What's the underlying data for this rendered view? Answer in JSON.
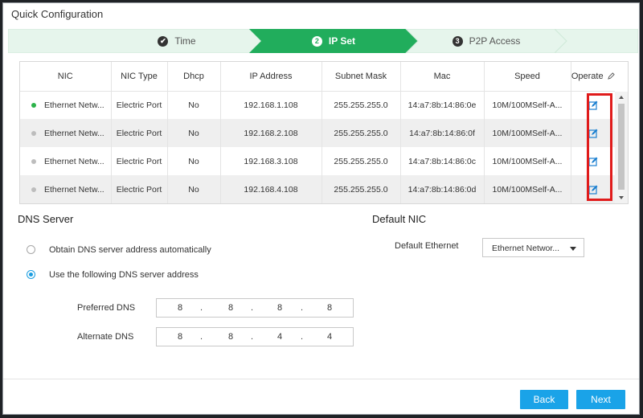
{
  "dialog": {
    "title": "Quick Configuration"
  },
  "steps": [
    {
      "label": "Time",
      "marker": "✔",
      "state": "done"
    },
    {
      "label": "IP Set",
      "marker": "2",
      "state": "active"
    },
    {
      "label": "P2P Access",
      "marker": "3",
      "state": "pending"
    }
  ],
  "table": {
    "headers": [
      "NIC",
      "NIC Type",
      "Dhcp",
      "IP Address",
      "Subnet Mask",
      "Mac",
      "Speed",
      "Operate"
    ],
    "rows": [
      {
        "status": "online",
        "status_color": "#2db34a",
        "nic": "Ethernet Netw...",
        "type": "Electric Port",
        "dhcp": "No",
        "ip": "192.168.1.108",
        "mask": "255.255.255.0",
        "mac": "14:a7:8b:14:86:0e",
        "speed": "10M/100MSelf-A..."
      },
      {
        "status": "offline",
        "status_color": "#bdbdbd",
        "nic": "Ethernet Netw...",
        "type": "Electric Port",
        "dhcp": "No",
        "ip": "192.168.2.108",
        "mask": "255.255.255.0",
        "mac": "14:a7:8b:14:86:0f",
        "speed": "10M/100MSelf-A..."
      },
      {
        "status": "offline",
        "status_color": "#bdbdbd",
        "nic": "Ethernet Netw...",
        "type": "Electric Port",
        "dhcp": "No",
        "ip": "192.168.3.108",
        "mask": "255.255.255.0",
        "mac": "14:a7:8b:14:86:0c",
        "speed": "10M/100MSelf-A..."
      },
      {
        "status": "offline",
        "status_color": "#bdbdbd",
        "nic": "Ethernet Netw...",
        "type": "Electric Port",
        "dhcp": "No",
        "ip": "192.168.4.108",
        "mask": "255.255.255.0",
        "mac": "14:a7:8b:14:86:0d",
        "speed": "10M/100MSelf-A..."
      }
    ]
  },
  "dns": {
    "title": "DNS Server",
    "auto_label": "Obtain DNS server address automatically",
    "manual_label": "Use the following DNS server address",
    "selected": "manual",
    "preferred_label": "Preferred DNS",
    "preferred": [
      "8",
      "8",
      "8",
      "8"
    ],
    "alternate_label": "Alternate DNS",
    "alternate": [
      "8",
      "8",
      "4",
      "4"
    ]
  },
  "default_nic": {
    "title": "Default NIC",
    "label": "Default Ethernet",
    "value": "Ethernet Networ..."
  },
  "footer": {
    "back_label": "Back",
    "next_label": "Next"
  },
  "colors": {
    "accent": "#1aa3e8",
    "step_active": "#21ad5c",
    "step_done": "#e6f5ec",
    "highlight": "#e01b1b"
  }
}
